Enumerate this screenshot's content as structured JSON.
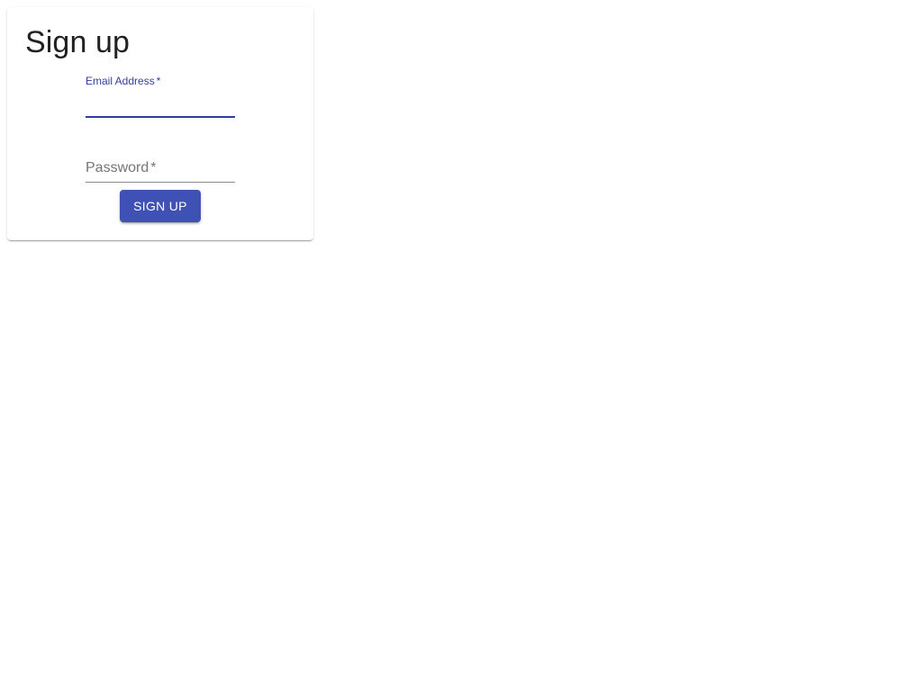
{
  "form": {
    "title": "Sign up",
    "email": {
      "label": "Email Address",
      "required_mark": "*",
      "value": ""
    },
    "password": {
      "label": "Password",
      "required_mark": "*",
      "value": ""
    },
    "submit_label": "SIGN UP"
  },
  "colors": {
    "accent": "#303f9f",
    "button": "#3f51b5",
    "title_text": "#212121",
    "placeholder_text": "#757575"
  }
}
